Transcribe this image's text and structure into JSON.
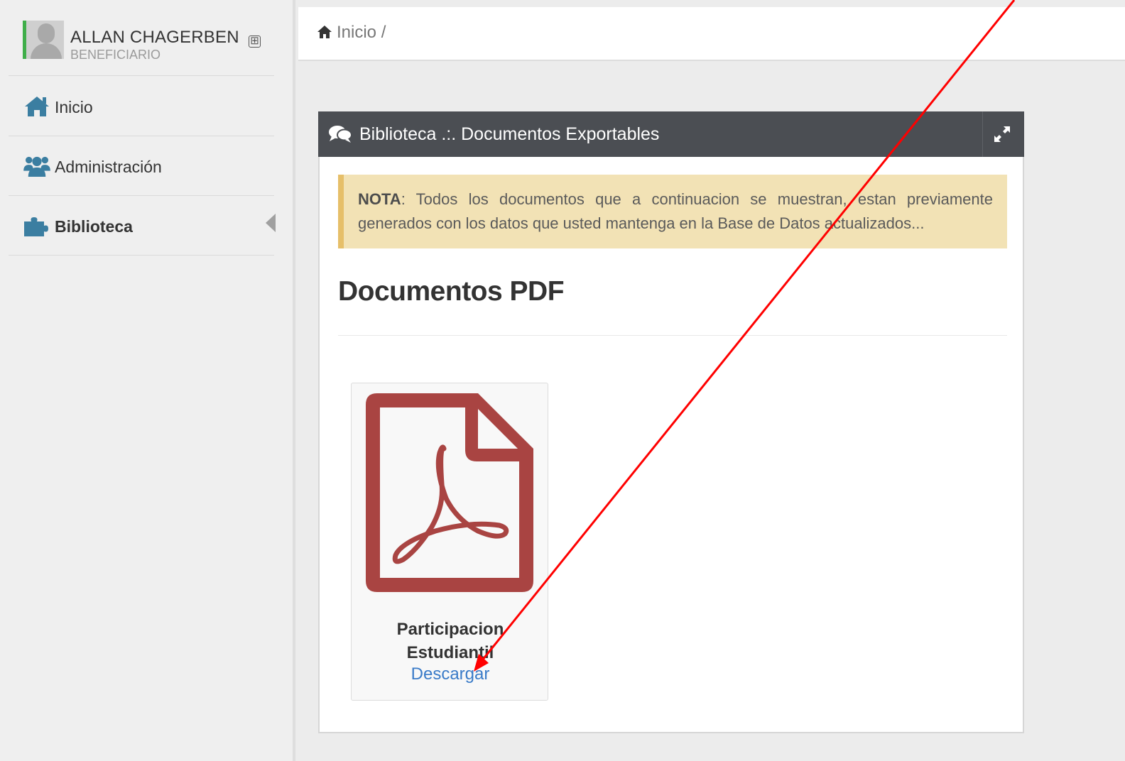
{
  "user": {
    "name": "ALLAN CHAGERBEN",
    "role": "BENEFICIARIO",
    "toggle_symbol": "⊞"
  },
  "sidebar": {
    "items": [
      {
        "label": "Inicio",
        "icon": "home-icon",
        "active": false
      },
      {
        "label": "Administración",
        "icon": "users-icon",
        "active": false
      },
      {
        "label": "Biblioteca",
        "icon": "puzzle-icon",
        "active": true
      }
    ]
  },
  "breadcrumb": {
    "items": [
      "Inicio",
      "/"
    ]
  },
  "panel": {
    "title": "Biblioteca .:. Documentos Exportables",
    "title_icon": "comments-icon",
    "expand_icon": "expand-icon",
    "header_color": "#4b4e53"
  },
  "note": {
    "label": "NOTA",
    "text": ": Todos los documentos que a continuacion se muestran, estan previamente generados con los datos que usted mantenga en la Base de Datos actualizados..."
  },
  "section": {
    "title": "Documentos PDF"
  },
  "documents": [
    {
      "name": "Participacion Estudiantil",
      "action": "Descargar",
      "icon": "pdf-file-icon",
      "icon_color": "#a94442"
    }
  ],
  "colors": {
    "accent_link": "#3a7bc8",
    "note_bg": "#f2e2b5",
    "note_border": "#e6bf69",
    "annotation_arrow": "#ff0000",
    "avatar_status": "#3fae49",
    "sidebar_icon": "#3b7ea1"
  }
}
